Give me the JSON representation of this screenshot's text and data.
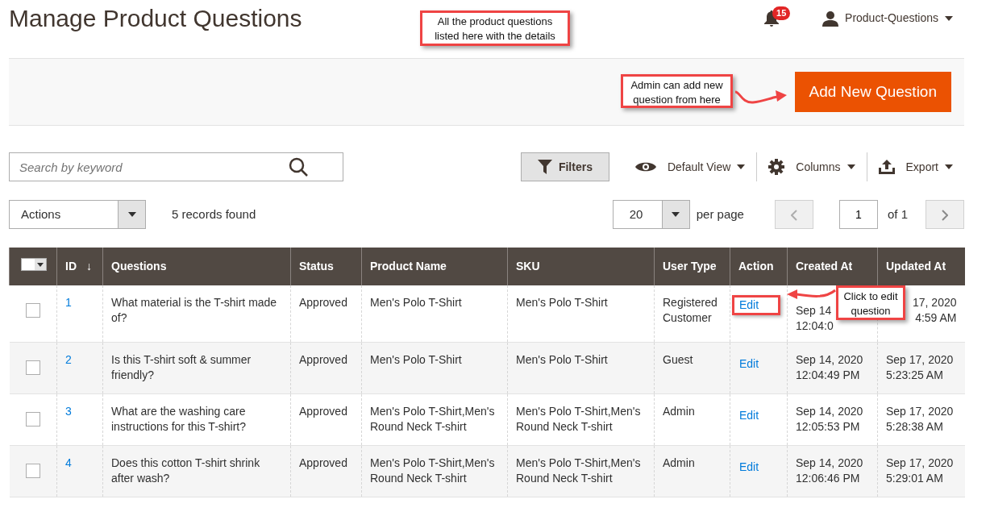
{
  "page_title": "Manage Product Questions",
  "notifications": {
    "count": "15"
  },
  "user": {
    "name": "Product-Questions"
  },
  "annotations": [
    {
      "text": "All the product questions listed here with the details"
    },
    {
      "text": "Admin can add new question from here"
    },
    {
      "text": "Click to edit question"
    }
  ],
  "add_button": "Add New Question",
  "search": {
    "placeholder": "Search by keyword"
  },
  "toolbar": {
    "filters": "Filters",
    "view": "Default View",
    "columns": "Columns",
    "export": "Export"
  },
  "actions": "Actions",
  "records": "5 records found",
  "pager": {
    "per_page": "20",
    "per_page_label": "per page",
    "page": "1",
    "of": "of 1"
  },
  "table": {
    "columns": [
      {
        "label": "ID",
        "sort": "↓"
      },
      {
        "label": "Questions"
      },
      {
        "label": "Status"
      },
      {
        "label": "Product Name"
      },
      {
        "label": "SKU"
      },
      {
        "label": "User Type"
      },
      {
        "label": "Action"
      },
      {
        "label": "Created At"
      },
      {
        "label": "Updated At"
      }
    ],
    "rows": [
      {
        "selected": false,
        "highlighted": true,
        "cells": [
          "1",
          "What material is the T-shirt made of?",
          "Approved",
          "Men's Polo T-Shirt",
          "Men's Polo T-Shirt",
          "Registered Customer",
          "Edit",
          "Sep 14\n12:04:0",
          "17, 2020\n4:59 AM"
        ]
      },
      {
        "selected": false,
        "highlighted": false,
        "cells": [
          "2",
          "Is this T-shirt soft & summer friendly?",
          "Approved",
          "Men's Polo T-Shirt",
          "Men's Polo T-Shirt",
          "Guest",
          "Edit",
          "Sep 14, 2020 12:04:49 PM",
          "Sep 17, 2020 5:23:25 AM"
        ]
      },
      {
        "selected": false,
        "highlighted": false,
        "cells": [
          "3",
          "What are the washing care instructions for this T-shirt?",
          "Approved",
          "Men's Polo T-Shirt,Men's Round Neck T-shirt",
          "Men's Polo T-Shirt,Men's Round Neck T-shirt",
          "Admin",
          "Edit",
          "Sep 14, 2020 12:05:53 PM",
          "Sep 17, 2020 5:28:38 AM"
        ]
      },
      {
        "selected": false,
        "highlighted": false,
        "cells": [
          "4",
          "Does this cotton T-shirt shrink after wash?",
          "Approved",
          "Men's Polo T-Shirt,Men's Round Neck T-shirt",
          "Men's Polo T-Shirt,Men's Round Neck T-shirt",
          "Admin",
          "Edit",
          "Sep 14, 2020 12:06:46 PM",
          "Sep 17, 2020 5:29:01 AM"
        ]
      }
    ]
  }
}
